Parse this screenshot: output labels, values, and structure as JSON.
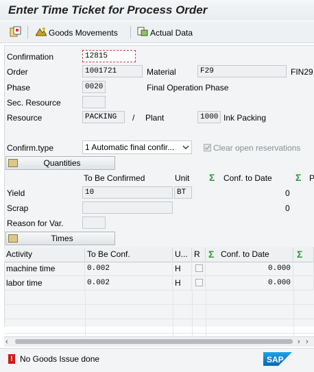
{
  "window": {
    "title": "Enter Time Ticket for Process Order"
  },
  "toolbar": {
    "goods_movements": "Goods Movements",
    "actual_data": "Actual Data"
  },
  "form": {
    "confirmation_label": "Confirmation",
    "confirmation_value": "12815",
    "order_label": "Order",
    "order_value": "1001721",
    "material_label": "Material",
    "material_value": "F29",
    "material_desc": "FIN29,",
    "phase_label": "Phase",
    "phase_value": "0020",
    "phase_desc": "Final Operation Phase",
    "sec_resource_label": "Sec. Resource",
    "sec_resource_value": "",
    "resource_label": "Resource",
    "resource_value": "PACKING",
    "slash": "/",
    "plant_label": "Plant",
    "plant_value": "1000",
    "plant_desc": "Ink Packing",
    "confirm_type_label": "Confirm.type",
    "confirm_type_value": "1 Automatic final confir...",
    "clear_reservations_label": "Clear open reservations"
  },
  "quantities": {
    "button_label": "Quantities",
    "to_be_confirmed_header": "To Be Confirmed",
    "unit_header": "Unit",
    "conf_to_date_header": "Conf. to Date",
    "p_header": "P",
    "yield_label": "Yield",
    "yield_value": "10",
    "yield_unit": "BT",
    "yield_conf": "0",
    "scrap_label": "Scrap",
    "scrap_value": "",
    "scrap_conf": "0",
    "reason_label": "Reason for Var.",
    "reason_value": ""
  },
  "times": {
    "button_label": "Times",
    "columns": {
      "activity": "Activity",
      "to_be_conf": "To Be Conf.",
      "unit": "U...",
      "r": "R",
      "conf_to_date": "Conf. to Date"
    },
    "rows": [
      {
        "activity": "machine time",
        "to_be_conf": "0.002",
        "unit": "H",
        "conf": "0.000"
      },
      {
        "activity": "labor time",
        "to_be_conf": "0.002",
        "unit": "H",
        "conf": "0.000"
      }
    ]
  },
  "status": {
    "message": "No Goods Issue done",
    "logo": "SAP"
  }
}
